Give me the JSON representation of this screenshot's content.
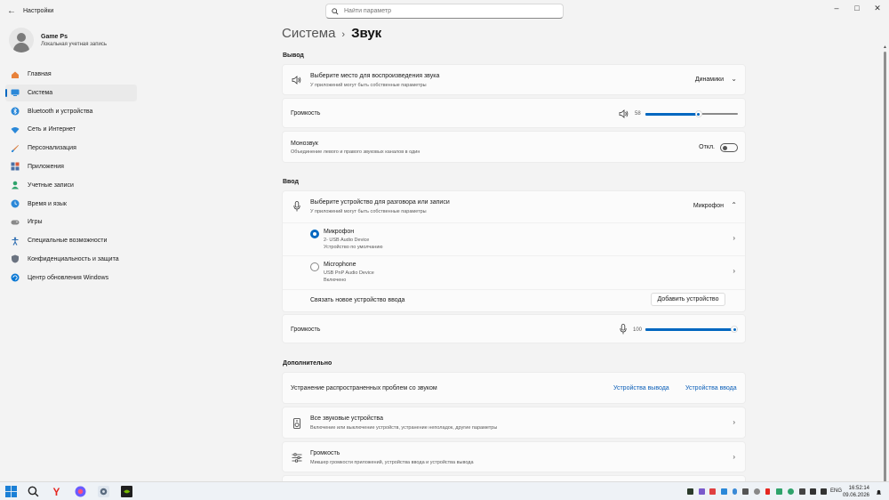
{
  "window": {
    "app_title": "Настройки"
  },
  "search": {
    "placeholder": "Найти параметр"
  },
  "profile": {
    "name": "Game Ps",
    "subtitle": "Локальная учетная запись"
  },
  "sidebar": {
    "items": [
      {
        "label": "Главная",
        "icon": "home-icon",
        "color": "#e8823a"
      },
      {
        "label": "Система",
        "icon": "system-icon",
        "color": "#2b88d8"
      },
      {
        "label": "Bluetooth и устройства",
        "icon": "bluetooth-icon",
        "color": "#2b88d8"
      },
      {
        "label": "Сеть и Интернет",
        "icon": "wifi-icon",
        "color": "#2b88d8"
      },
      {
        "label": "Персонализация",
        "icon": "brush-icon",
        "color": "#d97a3a"
      },
      {
        "label": "Приложения",
        "icon": "apps-icon",
        "color": "#4a6fa5"
      },
      {
        "label": "Учетные записи",
        "icon": "accounts-icon",
        "color": "#2fa36b"
      },
      {
        "label": "Время и язык",
        "icon": "globe-clock-icon",
        "color": "#2b88d8"
      },
      {
        "label": "Игры",
        "icon": "gamepad-icon",
        "color": "#8a8a8a"
      },
      {
        "label": "Специальные возможности",
        "icon": "accessibility-icon",
        "color": "#2b6cb0"
      },
      {
        "label": "Конфиденциальность и защита",
        "icon": "shield-icon",
        "color": "#6b7380"
      },
      {
        "label": "Центр обновления Windows",
        "icon": "update-icon",
        "color": "#0a78d4"
      }
    ]
  },
  "breadcrumb": {
    "parent": "Система",
    "separator": "›",
    "current": "Звук"
  },
  "output": {
    "section": "Вывод",
    "device": {
      "title": "Выберите место для воспроизведения звука",
      "subtitle": "У приложений могут быть собственные параметры",
      "value": "Динамики"
    },
    "volume": {
      "label": "Громкость",
      "value": "58",
      "level": 58
    },
    "mono": {
      "title": "Монозвук",
      "subtitle": "Объединение левого и правого звуковых каналов в один",
      "state": "Откл."
    }
  },
  "input": {
    "section": "Ввод",
    "device": {
      "title": "Выберите устройство для разговора или записи",
      "subtitle": "У приложений могут быть собственные параметры",
      "value": "Микрофон"
    },
    "devices": [
      {
        "name": "Микрофон",
        "line1": "2- USB Audio Device",
        "line2": "Устройство по умолчанию",
        "selected": true
      },
      {
        "name": "Microphone",
        "line1": "USB PnP Audio Device",
        "line2": "Включено",
        "selected": false
      }
    ],
    "pair": {
      "label": "Связать новое устройство ввода",
      "button": "Добавить устройство"
    },
    "volume": {
      "label": "Громкость",
      "value": "100",
      "level": 100
    }
  },
  "advanced": {
    "section": "Дополнительно",
    "troubleshoot": {
      "label": "Устранение распространенных проблем со звуком",
      "link_output": "Устройства вывода",
      "link_input": "Устройства ввода"
    },
    "all_devices": {
      "title": "Все звуковые устройства",
      "subtitle": "Включение или выключение устройств, устранение неполадок, другие параметры"
    },
    "mixer": {
      "title": "Громкость",
      "subtitle": "Микшер громкости приложений, устройства ввода и устройства вывода"
    }
  },
  "taskbar": {
    "language": "ENG",
    "time": "16:52:14",
    "date": "09.06.2026"
  },
  "colors": {
    "accent": "#0067c0"
  }
}
